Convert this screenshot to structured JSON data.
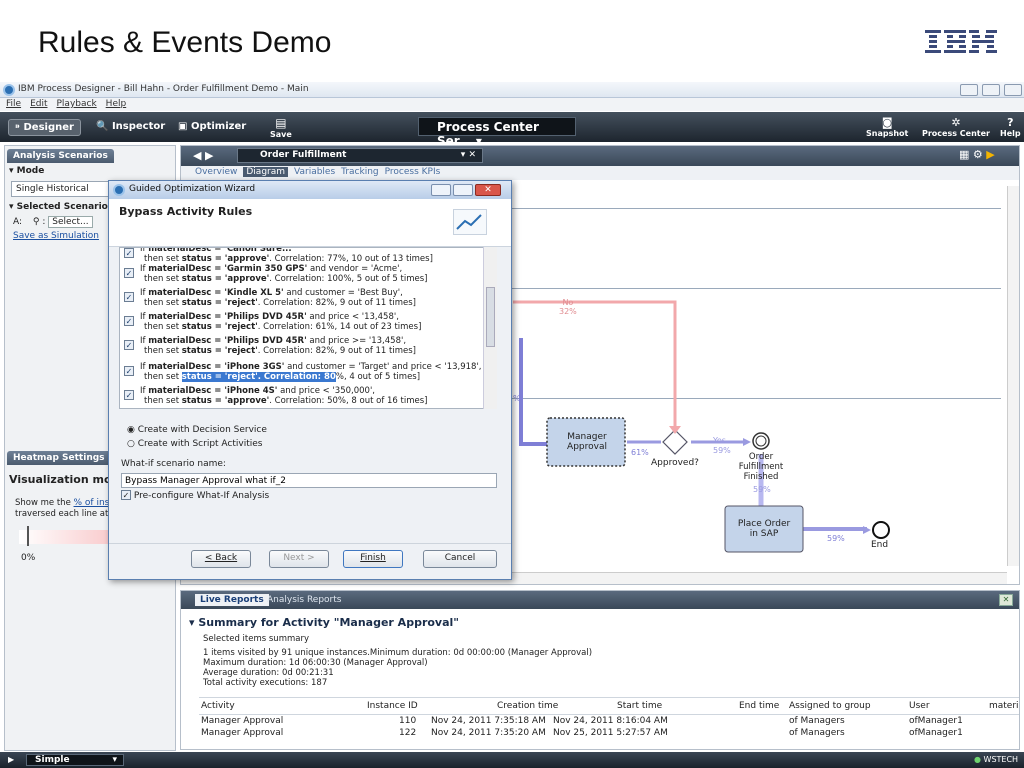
{
  "slide": {
    "title": "Rules & Events Demo"
  },
  "window": {
    "title": "IBM Process Designer - Bill Hahn - Order Fulfillment Demo - Main"
  },
  "menu": [
    "File",
    "Edit",
    "Playback",
    "Help"
  ],
  "toolbar": {
    "designer": "Designer",
    "inspector": "Inspector",
    "optimizer": "Optimizer",
    "save": "Save",
    "server": "Process Center Ser...",
    "snapshot": "Snapshot",
    "process_center": "Process Center",
    "help": "Help"
  },
  "left": {
    "analysis_title": "Analysis Scenarios",
    "mode_label": "Mode",
    "mode_value": "Single Historical",
    "selected_label": "Selected Scenarios",
    "a_label": "A:",
    "select_btn": "Select...",
    "save_sim": "Save as Simulation",
    "heatmap_title": "Heatmap Settings",
    "viz_mode": "Visualization mod",
    "show_me_1": "Show me the",
    "show_me_link": "% of inst",
    "show_me_2": "traversed each line at",
    "zero": "0%"
  },
  "canvas": {
    "process_name": "Order Fulfillment",
    "tabs": [
      "Overview",
      "Diagram",
      "Variables",
      "Tracking",
      "Process KPIs"
    ],
    "no_label": "No",
    "pct_32": "32%",
    "manager_approval": "Manager Approval",
    "pct_61": "61%",
    "approved": "Approved?",
    "yes": "Yes",
    "pct_59a": "59%",
    "order_fulfillment": "Order Fulfillment Finished",
    "pct_59b": "59%",
    "place_order": "Place Order in SAP",
    "pct_59c": "59%",
    "end": "End",
    "pct_left": "%"
  },
  "dialog": {
    "title": "Guided Optimization Wizard",
    "heading": "Bypass Activity Rules",
    "rules": [
      {
        "l1_pre": "If ",
        "l1_b": "materialDesc = 'Canon Sure...'",
        "l1_post": "",
        "l2_pre": "then set ",
        "l2_b": "status = 'approve'",
        "l2_post": ". Correlation: 77%, 10 out of 13 times]"
      },
      {
        "l1_pre": "If ",
        "l1_b": "materialDesc = 'Garmin 350 GPS'",
        "l1_post": " and vendor = 'Acme',",
        "l2_pre": "then set ",
        "l2_b": "status = 'approve'",
        "l2_post": ". Correlation: 100%, 5 out of 5 times]"
      },
      {
        "l1_pre": "If ",
        "l1_b": "materialDesc = 'Kindle XL 5'",
        "l1_post": " and customer = 'Best Buy',",
        "l2_pre": "then set ",
        "l2_b": "status = 'reject'",
        "l2_post": ". Correlation: 82%, 9 out of 11 times]"
      },
      {
        "l1_pre": "If ",
        "l1_b": "materialDesc = 'Philips DVD 45R'",
        "l1_post": " and price < '13,458',",
        "l2_pre": "then set ",
        "l2_b": "status = 'reject'",
        "l2_post": ". Correlation: 61%, 14 out of 23 times]"
      },
      {
        "l1_pre": "If ",
        "l1_b": "materialDesc = 'Philips DVD 45R'",
        "l1_post": " and price >= '13,458',",
        "l2_pre": "then set ",
        "l2_b": "status = 'reject'",
        "l2_post": ". Correlation: 82%, 9 out of 11 times]"
      },
      {
        "l1_pre": "If ",
        "l1_b": "materialDesc = 'iPhone 3GS'",
        "l1_post": " and customer = 'Target' and price < '13,918',",
        "l2_pre": "then set ",
        "l2_b": "status = 'reject'. Correlation: 80",
        "l2_post": "%, 4 out of 5 times]"
      },
      {
        "l1_pre": "If ",
        "l1_b": "materialDesc = 'iPhone 4S'",
        "l1_post": " and price < '350,000',",
        "l2_pre": "then set ",
        "l2_b": "status = 'approve'",
        "l2_post": ". Correlation: 50%, 8 out of 16 times]"
      }
    ],
    "radio1": "Create with Decision Service",
    "radio2": "Create with Script Activities",
    "whatif_label": "What-if scenario name:",
    "whatif_value": "Bypass Manager Approval what if_2",
    "preconfig": "Pre-configure What-If Analysis",
    "back": "< Back",
    "next": "Next >",
    "finish": "Finish",
    "cancel": "Cancel"
  },
  "reports": {
    "tab_live": "Live Reports",
    "tab_analysis": "Analysis Reports",
    "summary_title": "Summary for Activity \"Manager Approval\"",
    "selected_summary": "Selected items summary",
    "line1": "1 items visited by 91 unique instances.Minimum duration: 0d 00:00:00 (Manager Approval)",
    "line2": "Maximum duration: 1d 06:00:30 (Manager Approval)",
    "line3": "Average duration: 0d 00:21:31",
    "line4": "Total activity executions: 187",
    "headers": [
      "Activity",
      "Instance ID",
      "Creation time",
      "Start time",
      "End time",
      "Assigned to group",
      "User",
      "materi"
    ],
    "rows": [
      [
        "Manager Approval",
        "110",
        "Nov 24, 2011 7:35:18 AM",
        "Nov 24, 2011 8:16:04 AM",
        "",
        "of Managers",
        "ofManager1"
      ],
      [
        "Manager Approval",
        "122",
        "Nov 24, 2011 7:35:20 AM",
        "Nov 25, 2011 5:27:57 AM",
        "",
        "of Managers",
        "ofManager1"
      ]
    ]
  },
  "status": {
    "mode": "Simple",
    "right": "WSTECH"
  }
}
